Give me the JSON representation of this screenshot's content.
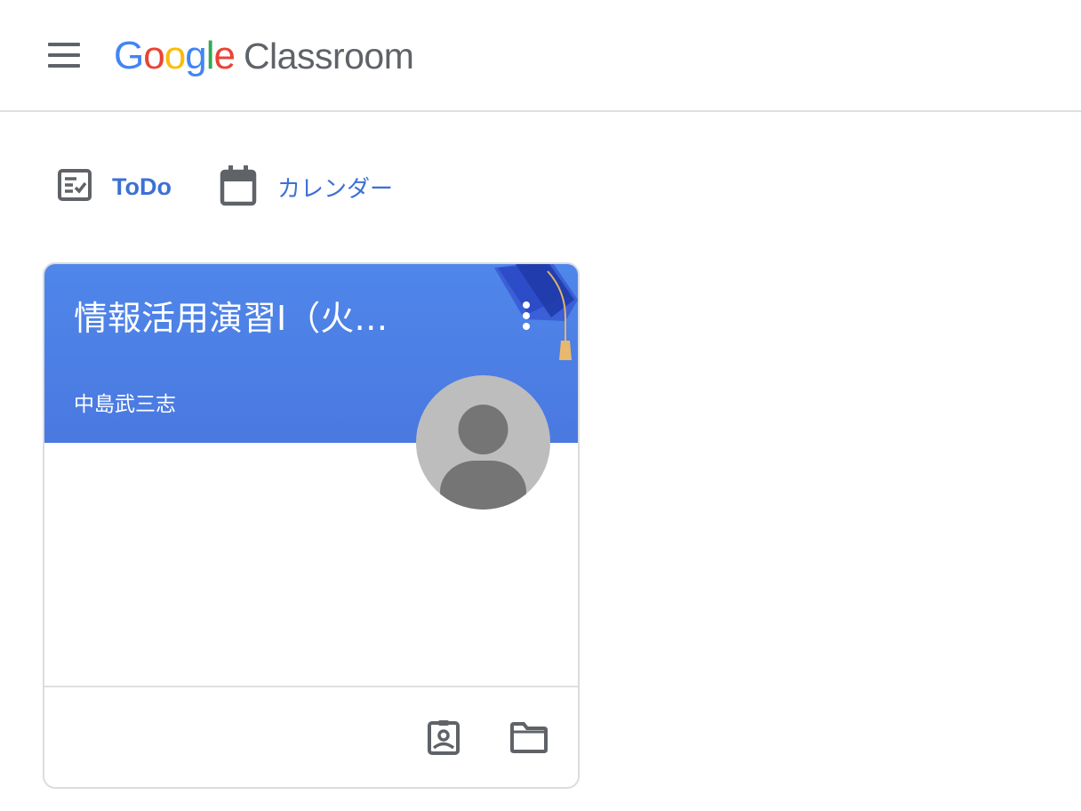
{
  "app": {
    "logo_google": [
      "G",
      "o",
      "o",
      "g",
      "l",
      "e"
    ],
    "logo_google_colors": [
      "#4285f4",
      "#ea4335",
      "#fbbc05",
      "#4285f4",
      "#34a853",
      "#ea4335"
    ],
    "logo_product": "Classroom",
    "menu_icon": "hamburger-menu-icon"
  },
  "nav": {
    "todo_label": "ToDo",
    "todo_icon": "todo-checklist-icon",
    "calendar_label": "カレンダー",
    "calendar_icon": "calendar-icon",
    "link_color": "#3c70d4"
  },
  "class_card": {
    "title": "情報活用演習Ⅰ（火…",
    "teacher": "中島武三志",
    "banner_color": "#4a7fe6",
    "more_icon": "more-vert-icon",
    "avatar_icon": "default-avatar-icon",
    "footer_icons": [
      "assignment-ind-icon",
      "folder-icon"
    ]
  }
}
